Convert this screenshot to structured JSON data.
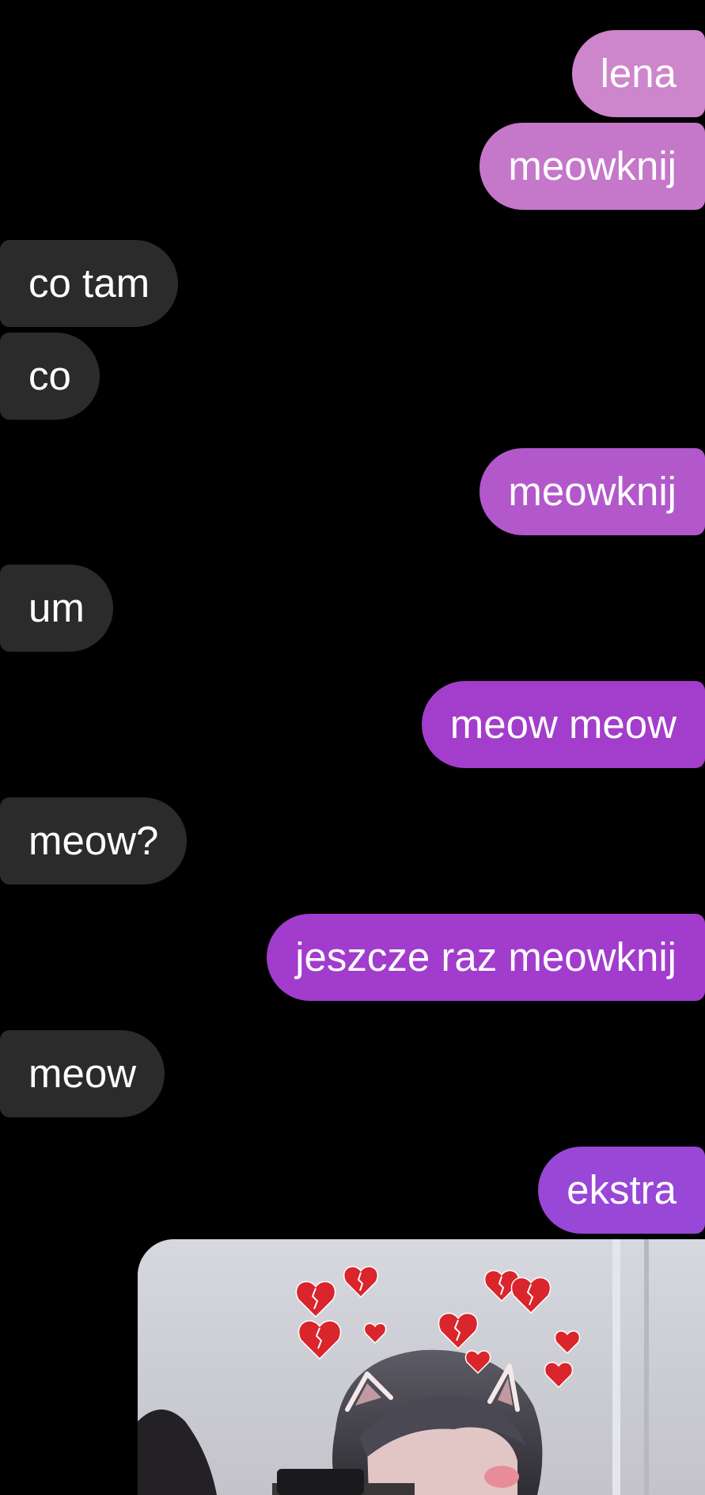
{
  "conversation": {
    "messages": [
      {
        "direction": "outgoing",
        "text": "lena",
        "color": "#cd85cc"
      },
      {
        "direction": "outgoing",
        "text": "meowknij",
        "color": "#c577c9"
      },
      {
        "direction": "incoming",
        "text": "co tam",
        "color": "#2b2b2b"
      },
      {
        "direction": "incoming",
        "text": "co",
        "color": "#2b2b2b"
      },
      {
        "direction": "outgoing",
        "text": "meowknij",
        "color": "#b258cb"
      },
      {
        "direction": "incoming",
        "text": "um",
        "color": "#2b2b2b"
      },
      {
        "direction": "outgoing",
        "text": "meow meow",
        "color": "#a33dcb"
      },
      {
        "direction": "incoming",
        "text": "meow?",
        "color": "#2b2b2b"
      },
      {
        "direction": "outgoing",
        "text": "jeszcze raz meowknij",
        "color": "#a13ccd"
      },
      {
        "direction": "incoming",
        "text": "meow",
        "color": "#2b2b2b"
      },
      {
        "direction": "outgoing",
        "text": "ekstra",
        "color": "#9847d6"
      }
    ],
    "attachment": {
      "kind": "photo",
      "description_icon": "photo-with-broken-hearts-and-cat-ears-filter"
    }
  },
  "theme": {
    "background": "#000000",
    "incoming_bubble": "#2b2b2b",
    "text_color": "#ffffff"
  }
}
